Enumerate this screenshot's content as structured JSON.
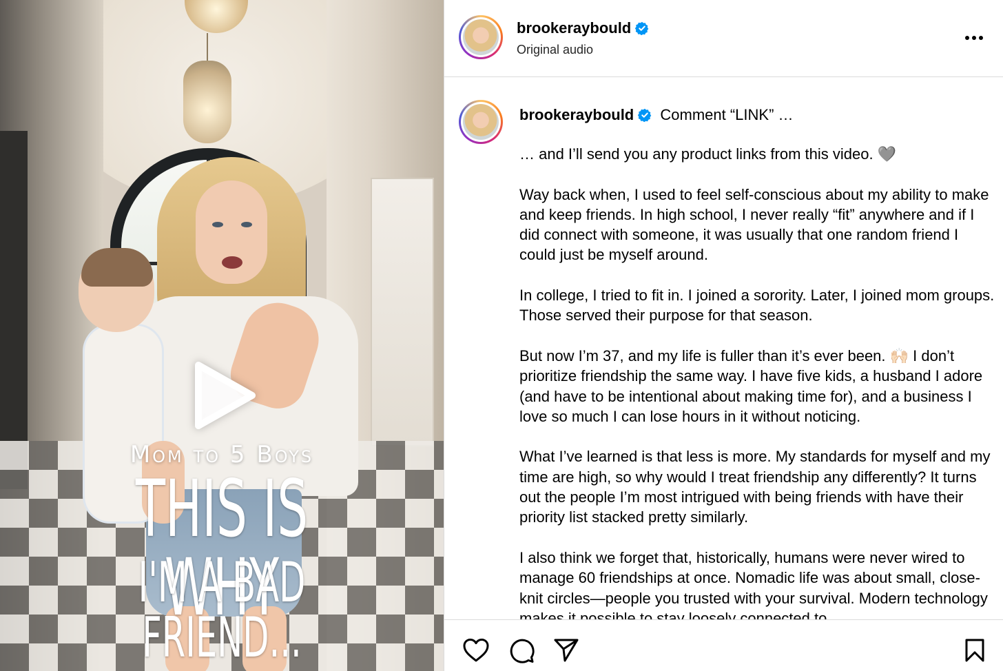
{
  "video": {
    "caption_small": "Mom to 5 Boys",
    "caption_big": "THIS IS WHY",
    "caption_tail": "I'M A BAD FRIEND...",
    "play_icon": "play-icon"
  },
  "post": {
    "username": "brookeraybould",
    "audio": "Original audio",
    "verified_icon": "verified-badge-icon",
    "more_icon": "more-options-icon"
  },
  "caption": {
    "username": "brookeraybould",
    "headline": "Comment “LINK” …",
    "paragraphs": [
      "… and I’ll send you any product links from this video. 🩶",
      "Way back when, I used to feel self-conscious about my ability to make and keep friends. In high school, I never really “fit” anywhere and if I did connect with someone, it was usually that one random friend I could just be myself around.",
      "In college, I tried to fit in. I joined a sorority. Later, I joined mom groups. Those served their purpose for that season.",
      "But now I’m 37, and my life is fuller than it’s ever been. 🙌🏻 I don’t prioritize friendship the same way. I have five kids, a husband I adore (and have to be intentional about making time for), and a business I love so much I can lose hours in it without noticing.",
      "What I’ve learned is that less is more. My standards for myself and my time are high, so why would I treat friendship any differently? It turns out the people I’m most intrigued with being friends with have their priority list stacked pretty similarly.",
      "I also think we forget that, historically, humans were never wired to manage 60 friendships at once. Nomadic life was about small, close-knit circles—people you trusted with your survival. Modern technology makes it possible to stay loosely connected to"
    ]
  },
  "actions": {
    "like_icon": "heart-icon",
    "comment_icon": "comment-icon",
    "share_icon": "send-icon",
    "save_icon": "bookmark-icon"
  },
  "colors": {
    "verified": "#0095f6",
    "border": "#dbdbdb",
    "text": "#000000"
  }
}
